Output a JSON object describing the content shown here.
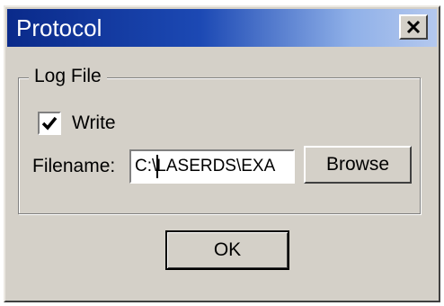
{
  "window": {
    "title": "Protocol",
    "close_icon": "close-icon"
  },
  "log_file_group": {
    "legend": "Log File",
    "write_checkbox": {
      "label": "Write",
      "checked": true
    },
    "filename": {
      "label": "Filename:",
      "value": "C:\\LASERDS\\EXA"
    },
    "browse_label": "Browse"
  },
  "buttons": {
    "ok_label": "OK"
  },
  "colors": {
    "titlebar_start": "#0a2a8a",
    "titlebar_end": "#b4c8ee",
    "dialog_face": "#d4d0c8"
  }
}
